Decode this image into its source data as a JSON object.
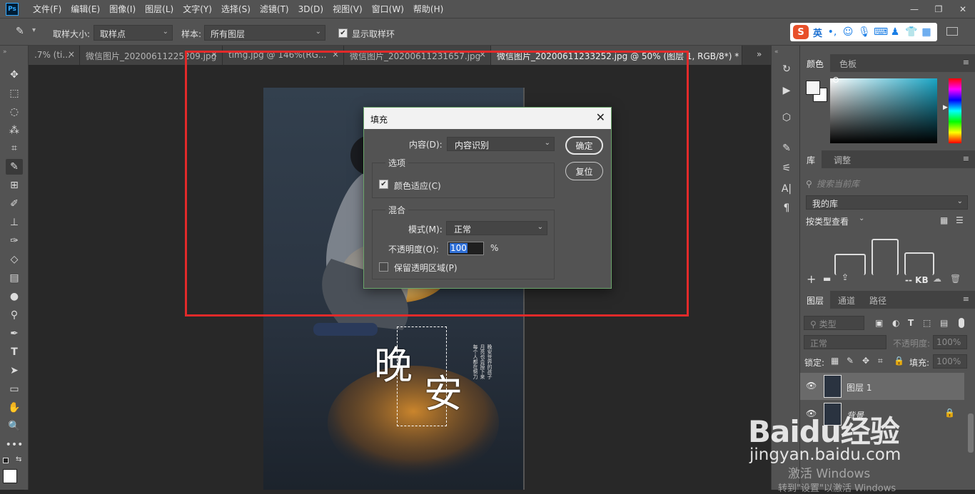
{
  "app": {
    "logo": "Ps"
  },
  "menu": [
    "文件(F)",
    "编辑(E)",
    "图像(I)",
    "图层(L)",
    "文字(Y)",
    "选择(S)",
    "滤镜(T)",
    "3D(D)",
    "视图(V)",
    "窗口(W)",
    "帮助(H)"
  ],
  "window_controls": [
    "—",
    "❐",
    "✕"
  ],
  "options": {
    "sample_size_label": "取样大小:",
    "sample_size_value": "取样点",
    "sample_label": "样本:",
    "sample_value": "所有图层",
    "show_ring_label": "显示取样环",
    "show_ring_checked": true
  },
  "ime": {
    "logo": "S",
    "lang": "英"
  },
  "tabs": [
    {
      "label": ".7% (ti...",
      "close": "×"
    },
    {
      "label": "微信图片_20200611225209.jpg",
      "close": "×"
    },
    {
      "label": "timg.jpg @ 146%(RG...",
      "close": "×"
    },
    {
      "label": "微信图片_20200611231657.jpg",
      "close": "×"
    },
    {
      "label": "微信图片_20200611233252.jpg @ 50% (图层 1, RGB/8*) *",
      "close": "×",
      "active": true
    }
  ],
  "tabs_overflow": "»",
  "dialog": {
    "title": "填充",
    "close": "✕",
    "content_label": "内容(D):",
    "content_value": "内容识别",
    "ok": "确定",
    "reset": "复位",
    "options_group": "选项",
    "color_adapt_label": "颜色适应(C)",
    "color_adapt_checked": true,
    "blend_group": "混合",
    "mode_label": "模式(M):",
    "mode_value": "正常",
    "opacity_label": "不透明度(O):",
    "opacity_value": "100",
    "opacity_unit": "%",
    "preserve_label": "保留透明区域(P)",
    "preserve_checked": false
  },
  "panels": {
    "color_tabs": [
      "颜色",
      "色板"
    ],
    "lib_tabs": [
      "库",
      "调整"
    ],
    "lib_search_placeholder": "搜索当前库",
    "lib_current": "我的库",
    "lib_view": "按类型查看",
    "lib_size": "-- KB",
    "layers_tabs": [
      "图层",
      "通道",
      "路径"
    ],
    "layers_filter": "类型",
    "blend_mode": "正常",
    "opacity_label": "不透明度:",
    "opacity_value": "100%",
    "lock_label": "锁定:",
    "fill_label": "填充:",
    "fill_value": "100%",
    "layers": [
      {
        "name": "图层 1",
        "visible": true,
        "selected": true
      },
      {
        "name": "背景",
        "visible": true,
        "locked": true
      }
    ]
  },
  "poster": {
    "title_chars": [
      "晚",
      "安"
    ],
    "side_text": [
      "每个人都在努力",
      "月亮也会掉下来",
      "晚安世界的孩子"
    ]
  },
  "watermark": {
    "brand": "Baidu经验",
    "url": "jingyan.baidu.com"
  },
  "activation": {
    "line1": "激活 Windows",
    "line2": "转到\"设置\"以激活 Windows"
  }
}
